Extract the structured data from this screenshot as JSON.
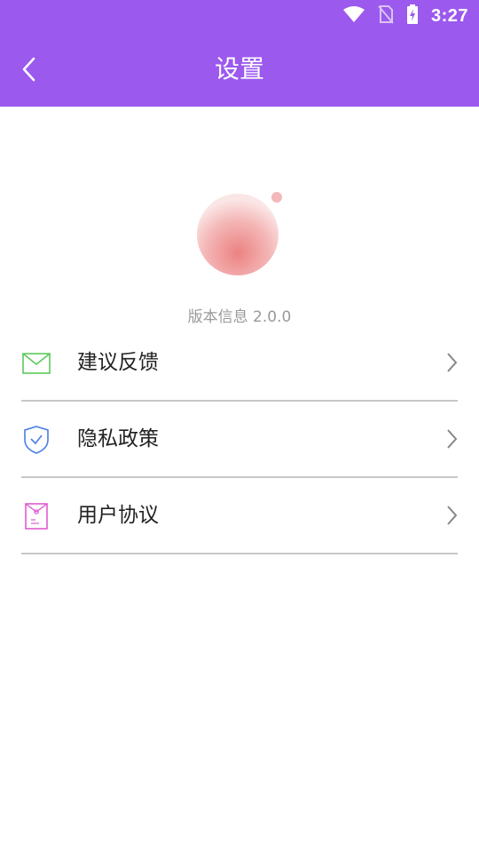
{
  "status_bar": {
    "time": "3:27"
  },
  "header": {
    "title": "设置"
  },
  "app": {
    "version_text": "版本信息 2.0.0"
  },
  "menu": {
    "items": [
      {
        "label": "建议反馈",
        "icon": "mail-icon"
      },
      {
        "label": "隐私政策",
        "icon": "shield-check-icon"
      },
      {
        "label": "用户协议",
        "icon": "document-icon"
      }
    ]
  },
  "colors": {
    "accent": "#9b59ee",
    "mail": "#5cc95c",
    "shield": "#4a7de8",
    "document": "#e05ad0"
  }
}
